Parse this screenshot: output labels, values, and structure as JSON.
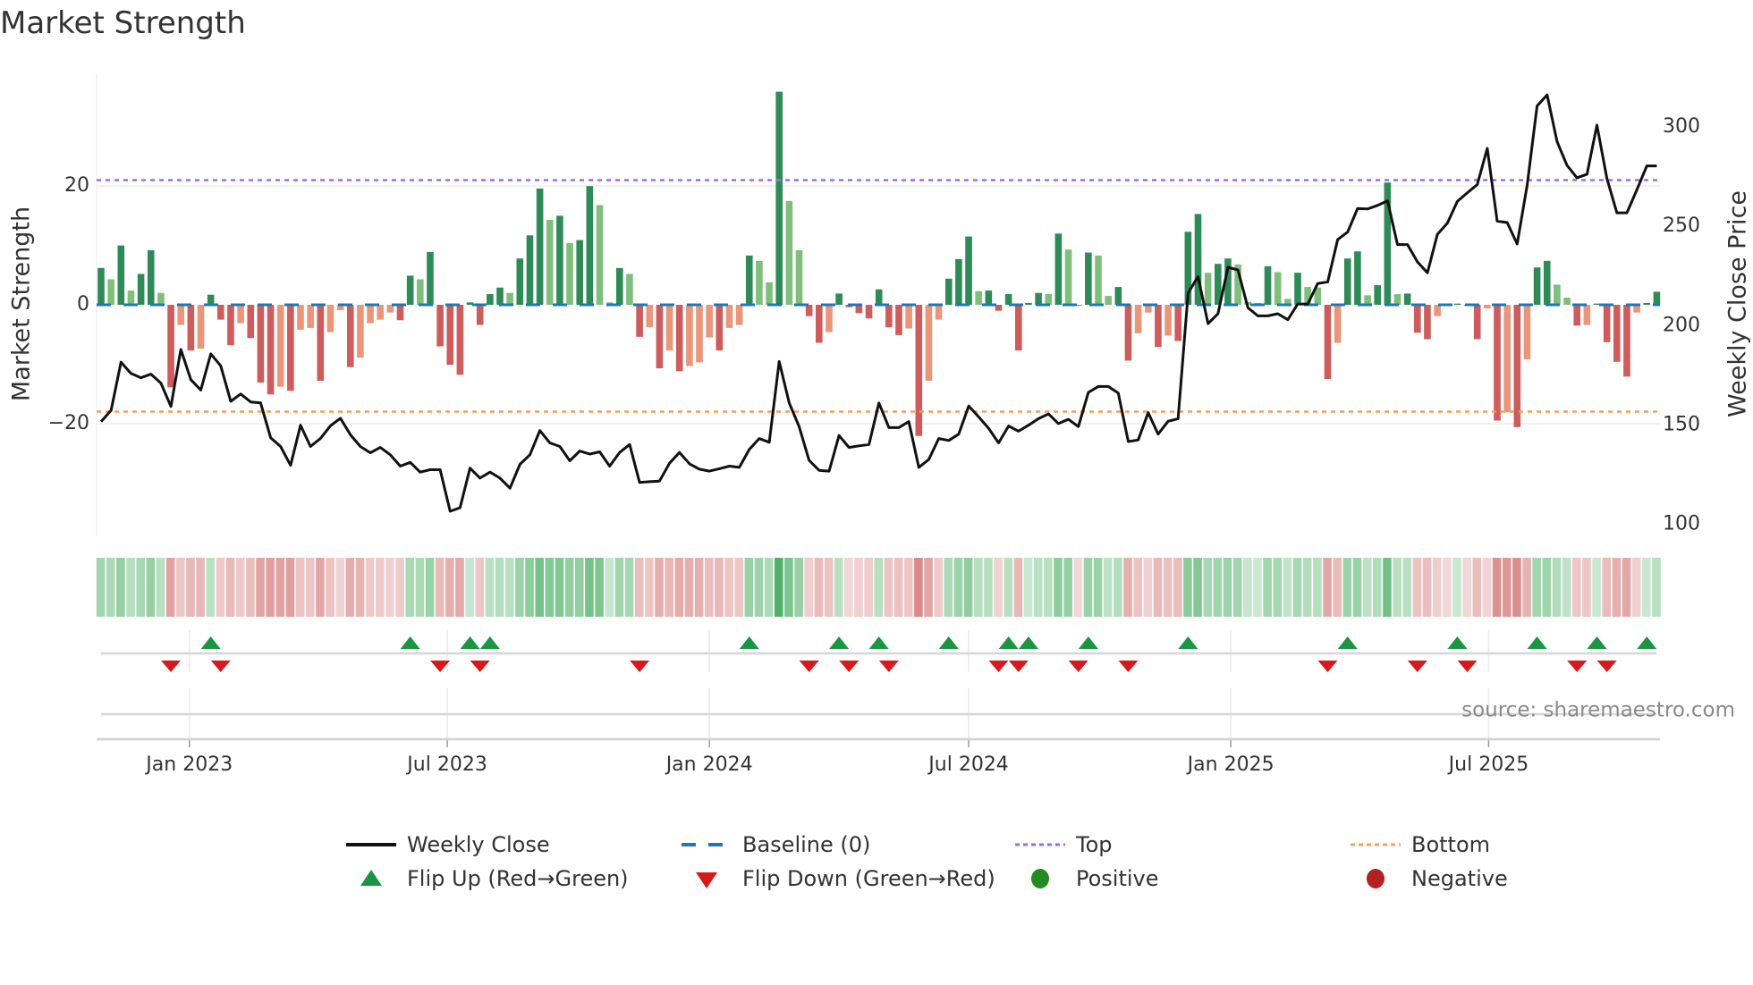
{
  "title": "Market Strength",
  "source": "source: sharemaestro.com",
  "colors": {
    "pos_up": "#2e8b57",
    "pos_down": "#7fbf7b",
    "neg_down": "#cd5c5c",
    "neg_up": "#e9967a",
    "baseline": "#1f77b4",
    "top": "#9b6fe0",
    "bottom": "#f0a060",
    "line": "#111111",
    "flip_up": "#1a9641",
    "flip_down": "#d7191c",
    "positive": "#228b22",
    "negative": "#b22222"
  },
  "legend": [
    {
      "label": "Weekly Close",
      "icon": "solid-line"
    },
    {
      "label": "Baseline (0)",
      "icon": "dashed-line"
    },
    {
      "label": "Top",
      "icon": "dotted-line-purple"
    },
    {
      "label": "Bottom",
      "icon": "dotted-line-orange"
    },
    {
      "label": "Flip Up (Red→Green)",
      "icon": "triangle-up"
    },
    {
      "label": "Flip Down (Green→Red)",
      "icon": "triangle-down"
    },
    {
      "label": "Positive",
      "icon": "circle-green"
    },
    {
      "label": "Negative",
      "icon": "circle-red"
    }
  ],
  "chart_data": {
    "type": "bar",
    "title": "Market Strength",
    "ylabel": "Market Strength",
    "y2label": "Weekly Close Price",
    "ylim": [
      -39,
      39
    ],
    "y2lim": [
      94,
      327
    ],
    "yticks": [
      {
        "v": 20,
        "label": "20"
      },
      {
        "v": 0,
        "label": "0"
      },
      {
        "v": -20,
        "label": "−20"
      }
    ],
    "y2ticks": [
      {
        "v": 100,
        "label": "100"
      },
      {
        "v": 150,
        "label": "150"
      },
      {
        "v": 200,
        "label": "200"
      },
      {
        "v": 250,
        "label": "250"
      },
      {
        "v": 300,
        "label": "300"
      }
    ],
    "xticks": [
      {
        "date": "2023-01-01",
        "label": "Jan 2023"
      },
      {
        "date": "2023-07-01",
        "label": "Jul 2023"
      },
      {
        "date": "2024-01-01",
        "label": "Jan 2024"
      },
      {
        "date": "2024-07-01",
        "label": "Jul 2024"
      },
      {
        "date": "2025-01-01",
        "label": "Jan 2025"
      },
      {
        "date": "2025-07-01",
        "label": "Jul 2025"
      }
    ],
    "start_date": "2022-10-31",
    "interval_days": 7,
    "top_level": 21,
    "bottom_level": -18,
    "strength": [
      6.2,
      4.3,
      10,
      2.4,
      5.2,
      9.2,
      2,
      -13.9,
      -3.4,
      -7.7,
      -7.4,
      1.7,
      -2.5,
      -6.8,
      -3.1,
      -5.6,
      -13.1,
      -15.1,
      -13.8,
      -14.5,
      -4.2,
      -3.9,
      -12.8,
      -4.6,
      -0.9,
      -10.5,
      -8.9,
      -3.1,
      -2.5,
      -1.3,
      -2.6,
      4.9,
      4.3,
      8.9,
      -7,
      -10.1,
      -11.8,
      0.4,
      -3.4,
      1.8,
      2.9,
      2,
      7.8,
      11.7,
      19.6,
      14.3,
      15,
      10.4,
      10.9,
      20,
      16.8,
      0.4,
      6.2,
      5.2,
      -5.4,
      -3.8,
      -10.7,
      -7.7,
      -11.2,
      -10.3,
      -9.7,
      -5.5,
      -7.7,
      -3.9,
      -3.4,
      8.3,
      7.4,
      3.8,
      35.9,
      17.5,
      9.2,
      -1.9,
      -6.4,
      -4.6,
      1.9,
      -0.4,
      -1.4,
      -2.3,
      2.6,
      -3.8,
      -5.1,
      -4,
      -22.1,
      -12.8,
      -2.5,
      4.4,
      7.7,
      11.5,
      2.3,
      2.4,
      -1,
      1.8,
      -7.7,
      0.3,
      2,
      1.8,
      12,
      9.3,
      -0.1,
      8.8,
      8.3,
      1.5,
      3,
      -9.4,
      -4.8,
      -1.3,
      -7.1,
      -5.2,
      -6.1,
      12.3,
      15.3,
      5.4,
      6.9,
      7.8,
      6.8,
      0.5,
      0.3,
      6.5,
      5.5,
      1,
      5.4,
      3,
      2.9,
      -12.5,
      -6.4,
      7.8,
      9,
      1.6,
      3.3,
      20.6,
      1.8,
      1.9,
      -4.7,
      -5.8,
      -1.9,
      -0.2,
      0.2,
      -0.1,
      -5.8,
      -0.6,
      -19.5,
      -18.1,
      -20.6,
      -9.2,
      6.3,
      7.4,
      3.4,
      1.2,
      -3.5,
      -3.4,
      0.2,
      -6.3,
      -9.6,
      -12.1,
      -1.3,
      0.3,
      2.2
    ],
    "weekly_close": [
      151.7,
      157.4,
      181.6,
      176,
      173.8,
      175.6,
      171.1,
      159.3,
      188,
      172.8,
      167.6,
      185.8,
      179.8,
      161.9,
      165.6,
      161.6,
      161.1,
      143.6,
      139.2,
      129.7,
      149.9,
      139.2,
      143.2,
      149.6,
      153.4,
      145.1,
      139.2,
      136,
      138.7,
      135,
      129.3,
      131.2,
      126.3,
      127.5,
      127.5,
      106.6,
      108.4,
      128.3,
      123.3,
      126.3,
      123.3,
      118.2,
      130.2,
      135,
      147.2,
      141,
      139.2,
      132,
      136.9,
      135.4,
      136.5,
      129.3,
      136.2,
      140.2,
      121.1,
      121.5,
      121.8,
      130.8,
      136.2,
      130.5,
      127.8,
      126.8,
      128,
      129.3,
      128.7,
      137.7,
      143.2,
      141.3,
      182,
      161.1,
      149.2,
      132.3,
      127.2,
      126.8,
      144.7,
      138.7,
      139.5,
      140.2,
      161.1,
      148.7,
      148.7,
      151.7,
      128.7,
      132.7,
      143.2,
      142.2,
      145.4,
      159.6,
      154.1,
      148.4,
      141,
      149.5,
      146.9,
      149.9,
      153.2,
      155.6,
      150.7,
      152.9,
      149.2,
      166.4,
      169.4,
      169.4,
      166.1,
      141.7,
      142.5,
      156.2,
      145.4,
      151.9,
      153.2,
      216.4,
      224.7,
      201,
      206,
      229.4,
      228,
      209,
      204.9,
      204.9,
      206,
      203,
      210.9,
      210.9,
      221.2,
      222,
      243.3,
      247.1,
      259,
      258.7,
      260.5,
      262.8,
      240.8,
      240.8,
      232.1,
      226.6,
      245.9,
      251.6,
      262.5,
      266.8,
      271,
      289.2,
      252.6,
      251.9,
      241.1,
      270.7,
      310.6,
      316.1,
      292.7,
      280.7,
      274.4,
      276.2,
      300.9,
      274,
      256.8,
      256.8,
      268.3,
      280.4,
      280.4
    ]
  }
}
